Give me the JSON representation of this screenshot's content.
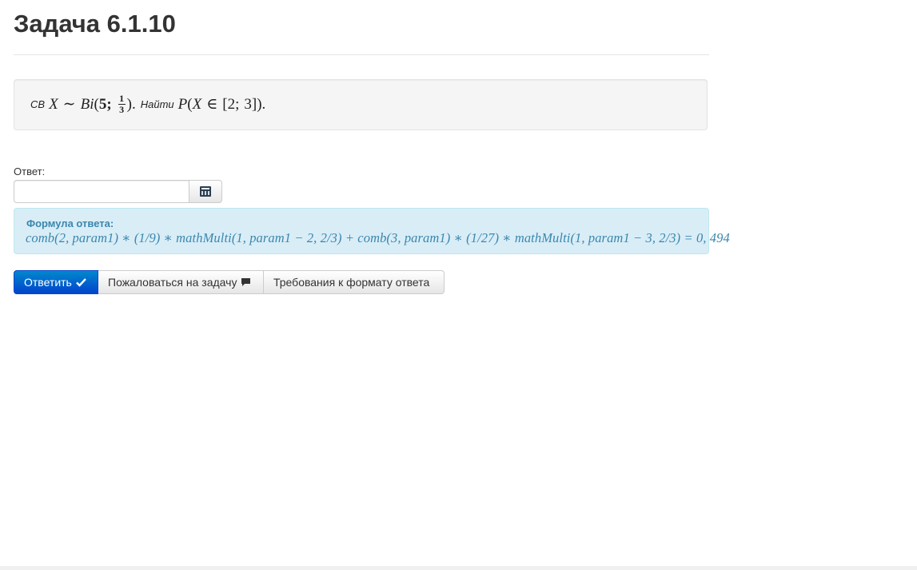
{
  "page": {
    "title": "Задача 6.1.10"
  },
  "problem": {
    "prefix": "СВ",
    "find_word": "Найти"
  },
  "answer": {
    "label": "Ответ:",
    "value": "",
    "placeholder": ""
  },
  "formula": {
    "label": "Формула ответа:",
    "text": "comb(2, param1) ∗ (1/9) ∗ mathMulti(1, param1 − 2, 2/3) + comb(3, param1) ∗ (1/27) ∗ mathMulti(1, param1 − 3, 2/3) = 0, 494"
  },
  "buttons": {
    "submit_label": "Ответить",
    "complain_label": "Пожаловаться на задачу",
    "format_label": "Требования к формату ответа"
  },
  "icons": {
    "submit": "check-icon",
    "complain": "comment-icon",
    "calculator": "calculator-icon"
  },
  "colors": {
    "primary": "#0055cc",
    "info_bg": "#d9edf7",
    "info_text": "#3a87ad",
    "well_bg": "#f5f5f5"
  }
}
